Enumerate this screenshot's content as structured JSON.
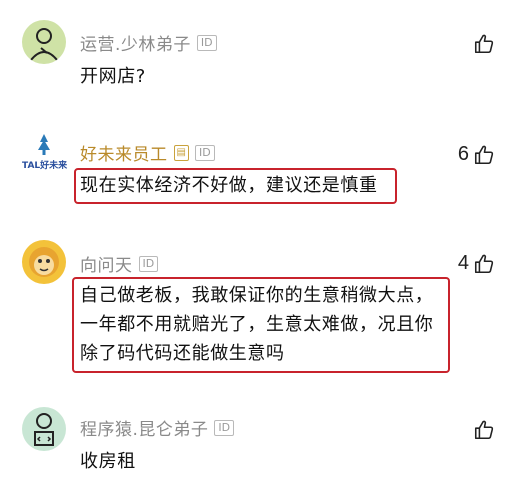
{
  "comments": [
    {
      "username": "运营.少林弟子",
      "id_badge": "ID",
      "text": "开网店?",
      "likes": ""
    },
    {
      "username": "好未来员工",
      "id_badge": "ID",
      "text": "现在实体经济不好做，建议还是慎重",
      "likes": "6",
      "logo_text": "TAL好未来"
    },
    {
      "username": "向问天",
      "id_badge": "ID",
      "text_lines": [
        "自己做老板，我敢保证你的生意稍微大点，",
        "一年都不用就赔光了，生意太难做，况且你",
        "除了码代码还能做生意吗"
      ],
      "likes": "4"
    },
    {
      "username": "程序猿.昆仑弟子",
      "id_badge": "ID",
      "text": "收房租",
      "likes": ""
    }
  ],
  "icons": {
    "like": "thumbs-up-icon"
  },
  "colors": {
    "highlight": "#c8232c",
    "username": "#8a8a8a",
    "staff_name": "#b98a2a"
  }
}
